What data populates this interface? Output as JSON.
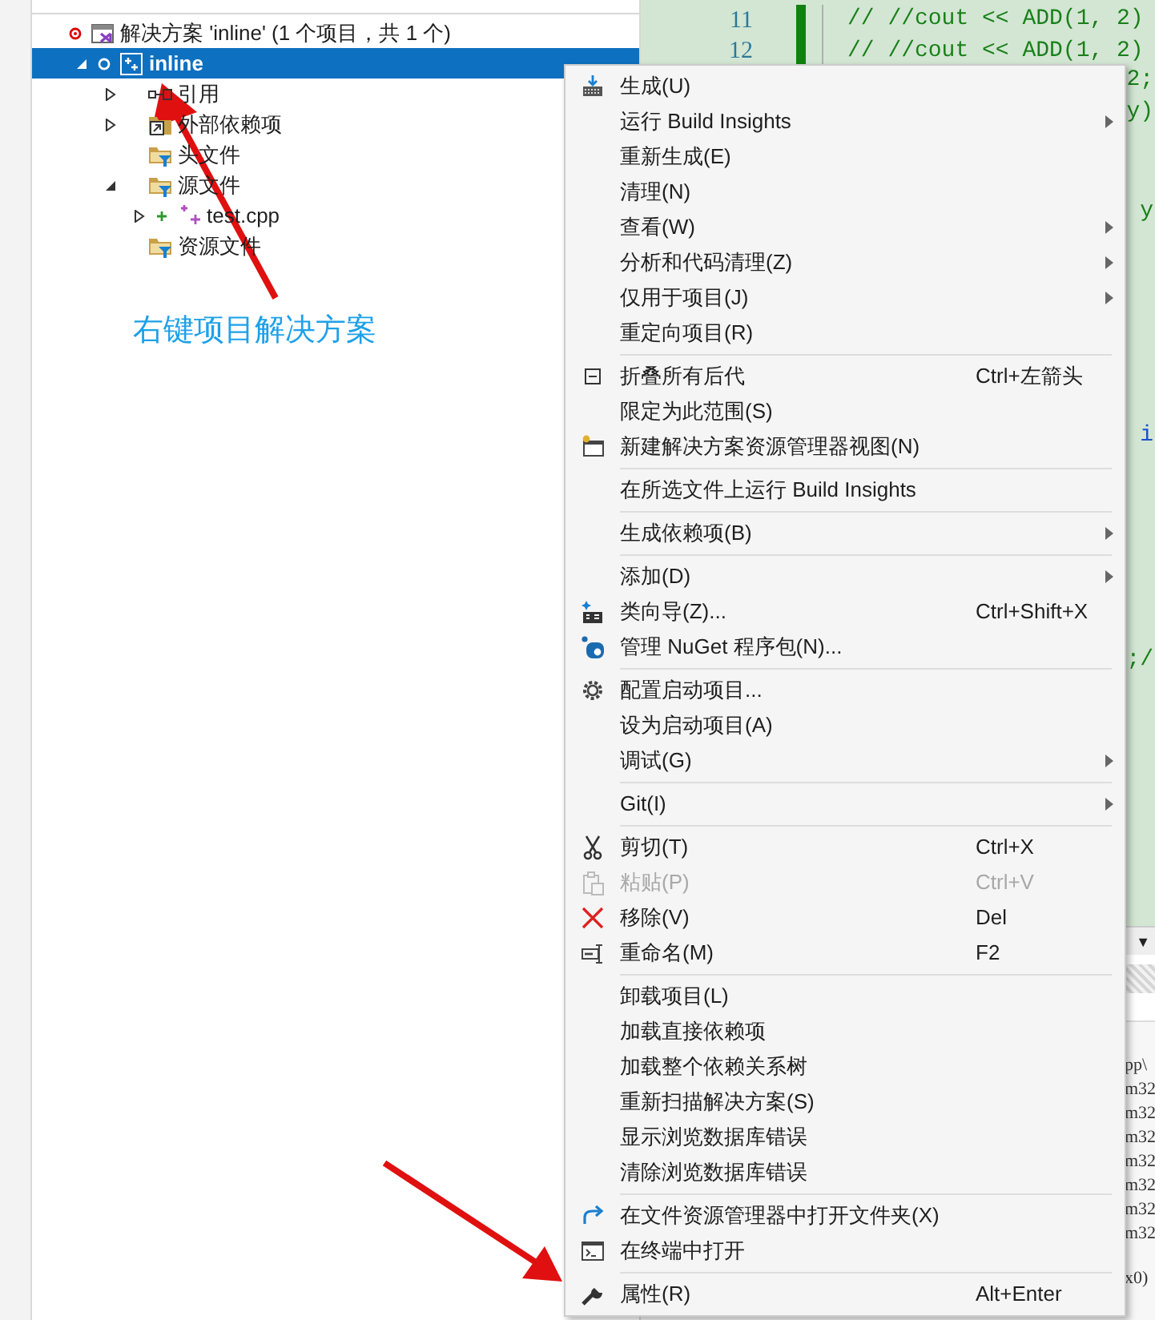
{
  "solution_explorer": {
    "tree": [
      {
        "label": "解决方案 'inline' (1 个项目，共 1 个)",
        "kind": "solution",
        "modified": true,
        "added": false,
        "selected": false,
        "children": [
          {
            "label": "inline",
            "kind": "project",
            "modified": true,
            "added": false,
            "selected": true,
            "expanded": true,
            "children": [
              {
                "label": "引用",
                "kind": "references",
                "modified": false,
                "added": false,
                "selected": false,
                "expanded": false
              },
              {
                "label": "外部依赖项",
                "kind": "external",
                "modified": false,
                "added": false,
                "selected": false,
                "expanded": false
              },
              {
                "label": "头文件",
                "kind": "filter",
                "modified": false,
                "added": false,
                "selected": false
              },
              {
                "label": "源文件",
                "kind": "filter",
                "modified": false,
                "added": false,
                "selected": false,
                "expanded": true,
                "children": [
                  {
                    "label": "test.cpp",
                    "kind": "cpp",
                    "modified": false,
                    "added": true,
                    "selected": false,
                    "expanded": false
                  }
                ]
              },
              {
                "label": "资源文件",
                "kind": "filter",
                "modified": false,
                "added": false,
                "selected": false
              }
            ]
          }
        ]
      }
    ]
  },
  "annotation": {
    "text": "右键项目解决方案"
  },
  "editor": {
    "lines": [
      {
        "number": "11",
        "text": "//  //cout << ADD(1, 2)"
      },
      {
        "number": "12",
        "text": "//  //cout << ADD(1, 2)"
      }
    ],
    "fragments": [
      "2;",
      "y)",
      "y",
      "i",
      ";/"
    ]
  },
  "output": {
    "dropdown_glyph": "▼",
    "fragments": [
      "pp\\",
      "m32",
      "m32",
      "m32",
      "m32",
      "m32",
      "m32",
      "m32",
      "x0)"
    ]
  },
  "context_menu": {
    "groups": [
      [
        {
          "label": "生成(U)",
          "kind": "build",
          "submenu": false,
          "disabled": false
        },
        {
          "label": "运行 Build Insights",
          "submenu": true,
          "disabled": false
        },
        {
          "label": "重新生成(E)",
          "submenu": false,
          "disabled": false
        },
        {
          "label": "清理(N)",
          "submenu": false,
          "disabled": false
        },
        {
          "label": "查看(W)",
          "submenu": true,
          "disabled": false
        },
        {
          "label": "分析和代码清理(Z)",
          "submenu": true,
          "disabled": false
        },
        {
          "label": "仅用于项目(J)",
          "submenu": true,
          "disabled": false
        },
        {
          "label": "重定向项目(R)",
          "submenu": false,
          "disabled": false
        }
      ],
      [
        {
          "label": "折叠所有后代",
          "kind": "collapse",
          "shortcut": "Ctrl+左箭头",
          "submenu": false,
          "disabled": false
        },
        {
          "label": "限定为此范围(S)",
          "submenu": false,
          "disabled": false
        },
        {
          "label": "新建解决方案资源管理器视图(N)",
          "kind": "window",
          "submenu": false,
          "disabled": false
        }
      ],
      [
        {
          "label": "在所选文件上运行 Build Insights",
          "submenu": false,
          "disabled": false
        }
      ],
      [
        {
          "label": "生成依赖项(B)",
          "submenu": true,
          "disabled": false
        }
      ],
      [
        {
          "label": "添加(D)",
          "submenu": true,
          "disabled": false
        },
        {
          "label": "类向导(Z)...",
          "kind": "wizard",
          "shortcut": "Ctrl+Shift+X",
          "submenu": false,
          "disabled": false
        },
        {
          "label": "管理 NuGet 程序包(N)...",
          "kind": "package",
          "submenu": false,
          "disabled": false
        }
      ],
      [
        {
          "label": "配置启动项目...",
          "kind": "gear",
          "submenu": false,
          "disabled": false
        },
        {
          "label": "设为启动项目(A)",
          "submenu": false,
          "disabled": false
        },
        {
          "label": "调试(G)",
          "submenu": true,
          "disabled": false
        }
      ],
      [
        {
          "label": "Git(I)",
          "submenu": true,
          "disabled": false
        }
      ],
      [
        {
          "label": "剪切(T)",
          "kind": "scissors",
          "shortcut": "Ctrl+X",
          "submenu": false,
          "disabled": false
        },
        {
          "label": "粘贴(P)",
          "kind": "paste",
          "shortcut": "Ctrl+V",
          "submenu": false,
          "disabled": true
        },
        {
          "label": "移除(V)",
          "kind": "remove",
          "shortcut": "Del",
          "submenu": false,
          "disabled": false
        },
        {
          "label": "重命名(M)",
          "kind": "rename",
          "shortcut": "F2",
          "submenu": false,
          "disabled": false
        }
      ],
      [
        {
          "label": "卸载项目(L)",
          "submenu": false,
          "disabled": false
        },
        {
          "label": "加载直接依赖项",
          "submenu": false,
          "disabled": false
        },
        {
          "label": "加载整个依赖关系树",
          "submenu": false,
          "disabled": false
        },
        {
          "label": "重新扫描解决方案(S)",
          "submenu": false,
          "disabled": false
        },
        {
          "label": "显示浏览数据库错误",
          "submenu": false,
          "disabled": false
        },
        {
          "label": "清除浏览数据库错误",
          "submenu": false,
          "disabled": false
        }
      ],
      [
        {
          "label": "在文件资源管理器中打开文件夹(X)",
          "kind": "folder",
          "submenu": false,
          "disabled": false
        },
        {
          "label": "在终端中打开",
          "kind": "terminal",
          "submenu": false,
          "disabled": false
        }
      ],
      [
        {
          "label": "属性(R)",
          "kind": "wrench",
          "shortcut": "Alt+Enter",
          "submenu": false,
          "disabled": false
        }
      ]
    ]
  }
}
